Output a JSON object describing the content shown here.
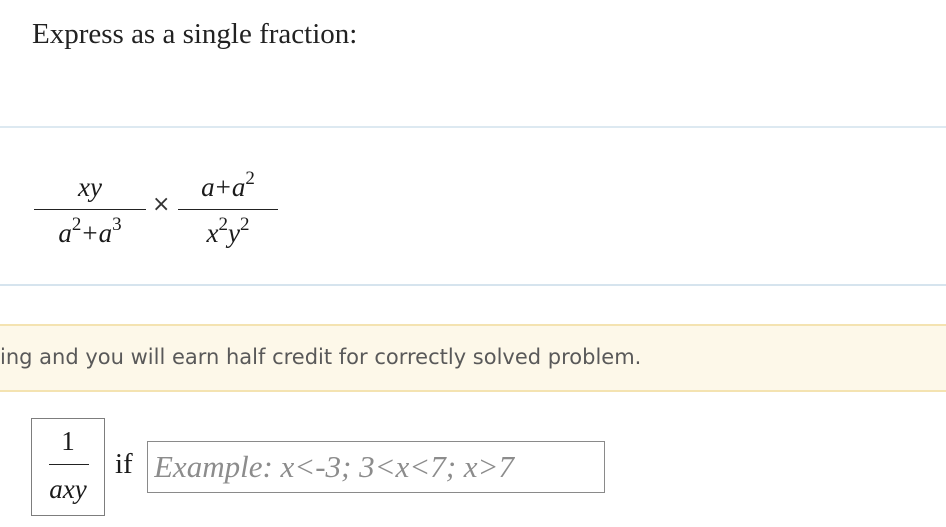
{
  "question": {
    "prompt": "Express as a single fraction:"
  },
  "expression": {
    "fraction1": {
      "numerator": "xy",
      "denominator_base1": "a",
      "denominator_exp1": "2",
      "denominator_op": "+",
      "denominator_base2": "a",
      "denominator_exp2": "3"
    },
    "operator": "×",
    "fraction2": {
      "numerator_base1": "a",
      "numerator_op": "+",
      "numerator_base2": "a",
      "numerator_exp2": "2",
      "denominator_base1": "x",
      "denominator_exp1": "2",
      "denominator_base2": "y",
      "denominator_exp2": "2"
    }
  },
  "banner": {
    "text": "ing and you will earn half credit for correctly solved problem."
  },
  "answer": {
    "numerator": "1",
    "denominator": "axy",
    "condition_word": "if",
    "domain_value": "",
    "domain_placeholder": "Example: x<-3; 3<x<7; x>7"
  }
}
